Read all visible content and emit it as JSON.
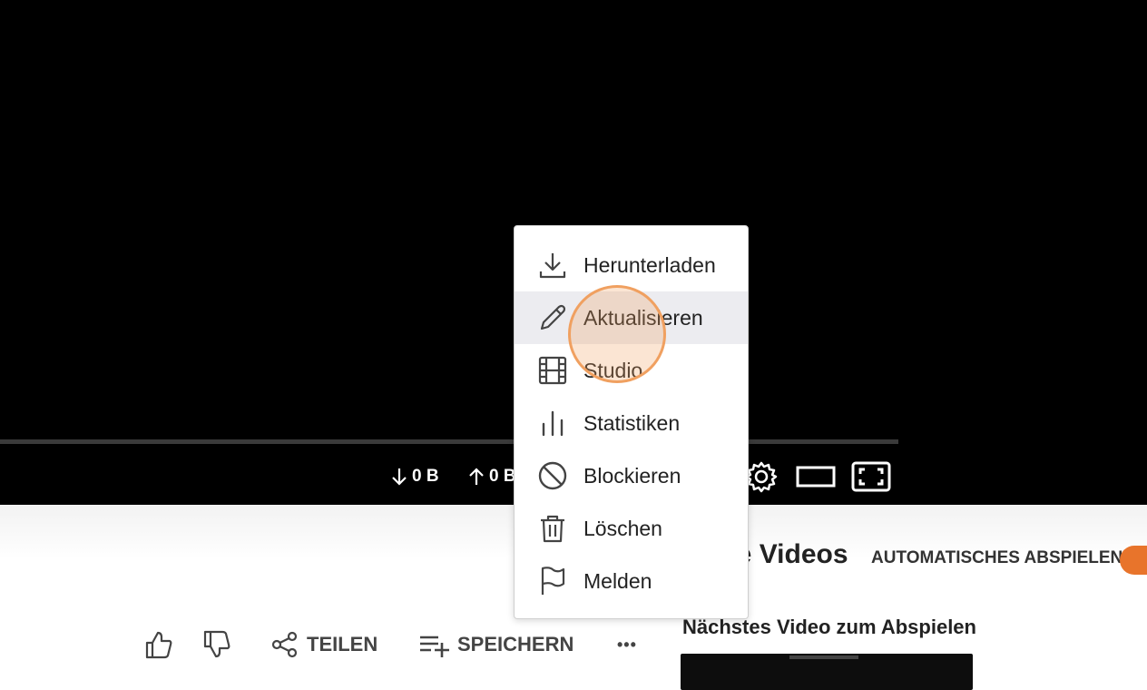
{
  "player": {
    "download_stat": "0 B",
    "upload_stat": "0 B"
  },
  "menu": {
    "items": [
      {
        "label": "Herunterladen",
        "icon": "download-icon"
      },
      {
        "label": "Aktualisieren",
        "icon": "pencil-icon"
      },
      {
        "label": "Studio",
        "icon": "film-icon"
      },
      {
        "label": "Statistiken",
        "icon": "bar-chart-icon"
      },
      {
        "label": "Blockieren",
        "icon": "block-icon"
      },
      {
        "label": "Löschen",
        "icon": "trash-icon"
      },
      {
        "label": "Melden",
        "icon": "flag-icon"
      }
    ],
    "hovered_index": 1
  },
  "actions": {
    "share_label": "TEILEN",
    "save_label": "SPEICHERN",
    "more_label": "•••"
  },
  "sidebar": {
    "other_videos_title": "re Videos",
    "autoplay_label": "AUTOMATISCHES ABSPIELEN",
    "autoplay_on": true,
    "next_video_title": "Nächstes Video zum Abspielen"
  },
  "colors": {
    "accent": "#e8742b",
    "hover_bg": "#ececf0"
  }
}
